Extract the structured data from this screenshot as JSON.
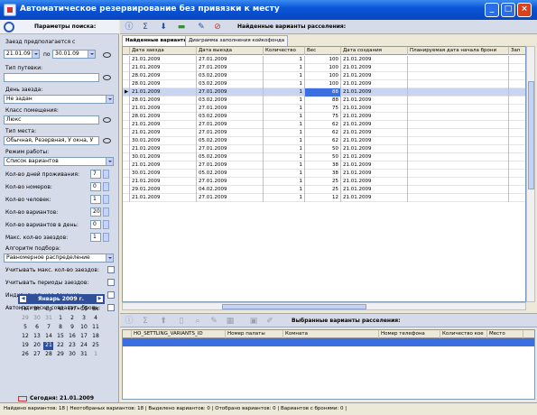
{
  "window": {
    "title": "Автоматическое резервирование без привязки к месту"
  },
  "left": {
    "header": "Параметры поиска:",
    "arrival_label": "Заезд предполагается с",
    "date_from": "21.01.09",
    "date_to_label": "по",
    "date_to": "30.01.09",
    "voucher_label": "Тип путевки:",
    "voucher_value": "",
    "arrival_day_label": "День заезда:",
    "arrival_day_value": "Не задан",
    "room_class_label": "Класс помещения:",
    "room_class_value": "Люкс",
    "place_type_label": "Тип места:",
    "place_type_value": "Обычная, Резервная, У окна, У",
    "mode_label": "Режим работы:",
    "mode_value": "Список вариантов",
    "days_label": "Кол-во дней проживания:",
    "days_value": "7",
    "rooms_label": "Кол-во номеров:",
    "rooms_value": "0",
    "people_label": "Кол-во человек:",
    "people_value": "1",
    "variants_label": "Кол-во вариантов:",
    "variants_value": "20",
    "variants_day_label": "Кол-во вариантов в день:",
    "variants_day_value": "0",
    "max_arrivals_label": "Макс. кол-во заездов:",
    "max_arrivals_value": "1",
    "algo_label": "Алгоритм подбора:",
    "algo_value": "Равномерное распределение",
    "chk1": "Учитывать макс. кол-во заездов:",
    "chk2": "Учитывать периоды заездов:",
    "chk3": "Индивидуальное лечение:",
    "chk4": "Автоматически создавать бронь:"
  },
  "calendar": {
    "month": "Январь 2009 г.",
    "weekdays": [
      "Пн",
      "Вт",
      "Ср",
      "Чт",
      "Пт",
      "Сб",
      "Вс"
    ],
    "rows": [
      [
        "29",
        "30",
        "31",
        "1",
        "2",
        "3",
        "4"
      ],
      [
        "5",
        "6",
        "7",
        "8",
        "9",
        "10",
        "11"
      ],
      [
        "12",
        "13",
        "14",
        "15",
        "16",
        "17",
        "18"
      ],
      [
        "19",
        "20",
        "21",
        "22",
        "23",
        "24",
        "25"
      ],
      [
        "26",
        "27",
        "28",
        "29",
        "30",
        "31",
        "1"
      ]
    ],
    "today": "Сегодня: 21.01.2009"
  },
  "toolbar": {
    "title": "Найденные варианты расселения:"
  },
  "tabs": [
    "Найденные варианты",
    "Диаграмма заполнения койкофонда"
  ],
  "grid": {
    "columns": [
      "Дата заезда",
      "Дата выезда",
      "Количество",
      "Вес",
      "Дата создания",
      "Планируемая дата начала брони",
      "Зап"
    ],
    "rows": [
      [
        "21.01.2009",
        "27.01.2009",
        "1",
        "100",
        "21.01.2009"
      ],
      [
        "21.01.2009",
        "27.01.2009",
        "1",
        "100",
        "21.01.2009"
      ],
      [
        "28.01.2009",
        "03.02.2009",
        "1",
        "100",
        "21.01.2009"
      ],
      [
        "28.01.2009",
        "03.02.2009",
        "1",
        "100",
        "21.01.2009"
      ],
      [
        "21.01.2009",
        "27.01.2009",
        "1",
        "88",
        "21.01.2009"
      ],
      [
        "28.01.2009",
        "03.02.2009",
        "1",
        "88",
        "21.01.2009"
      ],
      [
        "21.01.2009",
        "27.01.2009",
        "1",
        "75",
        "21.01.2009"
      ],
      [
        "28.01.2009",
        "03.02.2009",
        "1",
        "75",
        "21.01.2009"
      ],
      [
        "21.01.2009",
        "27.01.2009",
        "1",
        "62",
        "21.01.2009"
      ],
      [
        "21.01.2009",
        "27.01.2009",
        "1",
        "62",
        "21.01.2009"
      ],
      [
        "30.01.2009",
        "05.02.2009",
        "1",
        "62",
        "21.01.2009"
      ],
      [
        "21.01.2009",
        "27.01.2009",
        "1",
        "50",
        "21.01.2009"
      ],
      [
        "30.01.2009",
        "05.02.2009",
        "1",
        "50",
        "21.01.2009"
      ],
      [
        "21.01.2009",
        "27.01.2009",
        "1",
        "38",
        "21.01.2009"
      ],
      [
        "30.01.2009",
        "05.02.2009",
        "1",
        "38",
        "21.01.2009"
      ],
      [
        "21.01.2009",
        "27.01.2009",
        "1",
        "25",
        "21.01.2009"
      ],
      [
        "29.01.2009",
        "04.02.2009",
        "1",
        "25",
        "21.01.2009"
      ],
      [
        "21.01.2009",
        "27.01.2009",
        "1",
        "12",
        "21.01.2009"
      ]
    ]
  },
  "lower": {
    "title": "Выбранные варианты расселения:",
    "columns": [
      "HO_SETTLING_VARIANTS_ID",
      "Номер палаты",
      "Комната",
      "Номер телефона",
      "Количество кое",
      "Место"
    ]
  },
  "status": "Найдено вариантов: 18 | Неотобраных вариантов: 18 | Выделено вариантов: 0 | Отобрано вариантов: 0 | Вариантов с бронями: 0 |"
}
